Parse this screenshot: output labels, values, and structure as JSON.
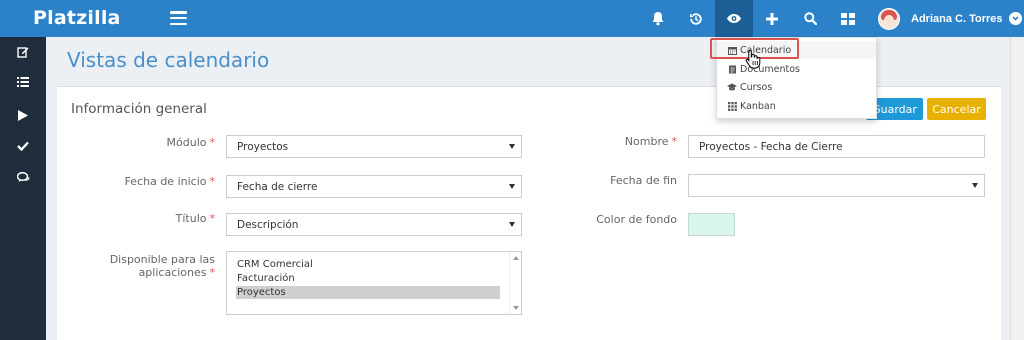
{
  "app": {
    "brand": "Platzilla"
  },
  "user": {
    "name": "Adriana C. Torres"
  },
  "page": {
    "title": "Vistas de calendario"
  },
  "panel": {
    "title": "Información general"
  },
  "actions": {
    "save_label": "Guardar",
    "cancel_label": "Cancelar"
  },
  "form": {
    "modulo": {
      "label": "Módulo",
      "value": "Proyectos"
    },
    "fecha_inicio": {
      "label": "Fecha de inicio",
      "value": "Fecha de cierre"
    },
    "titulo": {
      "label": "Título",
      "value": "Descripción"
    },
    "disponible": {
      "label_line1": "Disponible para las",
      "label_line2": "aplicaciones",
      "options": [
        "CRM Comercial",
        "Facturación",
        "Proyectos"
      ],
      "selected": "Proyectos"
    },
    "nombre": {
      "label": "Nombre",
      "value": "Proyectos - Fecha de Cierre"
    },
    "fecha_fin": {
      "label": "Fecha de fin",
      "value": ""
    },
    "color_fondo": {
      "label": "Color de fondo",
      "value": "#d8f6ee"
    }
  },
  "views_menu": {
    "items": [
      {
        "label": "Calendario",
        "icon": "calendar-icon"
      },
      {
        "label": "Documentos",
        "icon": "document-icon"
      },
      {
        "label": "Cursos",
        "icon": "graduation-cap-icon"
      },
      {
        "label": "Kanban",
        "icon": "kanban-icon"
      }
    ]
  },
  "colors": {
    "topbar": "#2b82c9",
    "sidebar": "#1f2d3d",
    "accent_title": "#4a8fc9",
    "save": "#1e9ad8",
    "cancel": "#e8b100",
    "required": "#d9534f"
  },
  "icons": {
    "sidebar": [
      "edit-icon",
      "list-icon",
      "play-icon",
      "check-icon",
      "comments-icon"
    ],
    "topbar": [
      "bell-icon",
      "history-icon",
      "eye-icon",
      "plus-icon",
      "search-icon",
      "grid-icon"
    ]
  }
}
